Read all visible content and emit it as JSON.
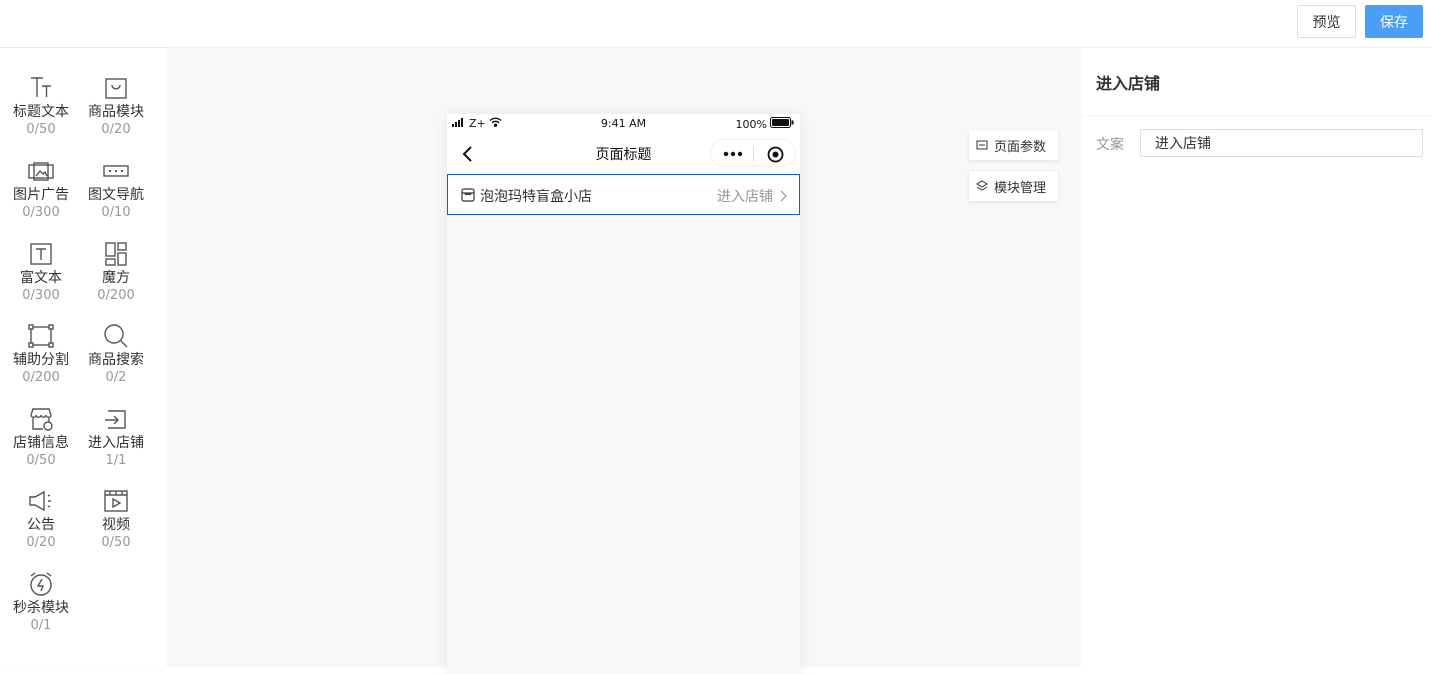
{
  "header": {
    "preview_label": "预览",
    "save_label": "保存",
    "save_color": "#4a9ff5"
  },
  "components": [
    {
      "icon": "title-text-icon",
      "label": "标题文本",
      "count": "0/50"
    },
    {
      "icon": "goods-bag-icon",
      "label": "商品模块",
      "count": "0/20"
    },
    {
      "icon": "image-ad-icon",
      "label": "图片广告",
      "count": "0/300"
    },
    {
      "icon": "image-nav-icon",
      "label": "图文导航",
      "count": "0/10"
    },
    {
      "icon": "rich-text-icon",
      "label": "富文本",
      "count": "0/300"
    },
    {
      "icon": "magic-cube-icon",
      "label": "魔方",
      "count": "0/200"
    },
    {
      "icon": "divider-icon",
      "label": "辅助分割",
      "count": "0/200"
    },
    {
      "icon": "search-icon",
      "label": "商品搜索",
      "count": "0/2"
    },
    {
      "icon": "store-info-icon",
      "label": "店铺信息",
      "count": "0/50"
    },
    {
      "icon": "enter-store-icon",
      "label": "进入店铺",
      "count": "1/1"
    },
    {
      "icon": "announcement-icon",
      "label": "公告",
      "count": "0/20"
    },
    {
      "icon": "video-icon",
      "label": "视频",
      "count": "0/50"
    },
    {
      "icon": "flash-sale-icon",
      "label": "秒杀模块",
      "count": "0/1"
    }
  ],
  "phone": {
    "carrier": "Z+",
    "time": "9:41 AM",
    "battery": "100%",
    "page_title": "页面标题",
    "store_name": "泡泡玛特盲盒小店",
    "enter_store_text": "进入店铺",
    "selected_border_color": "#155bd4"
  },
  "float_buttons": {
    "page_params": "页面参数",
    "module_manage": "模块管理"
  },
  "settings": {
    "title": "进入店铺",
    "copy_label": "文案",
    "copy_value": "进入店铺"
  }
}
